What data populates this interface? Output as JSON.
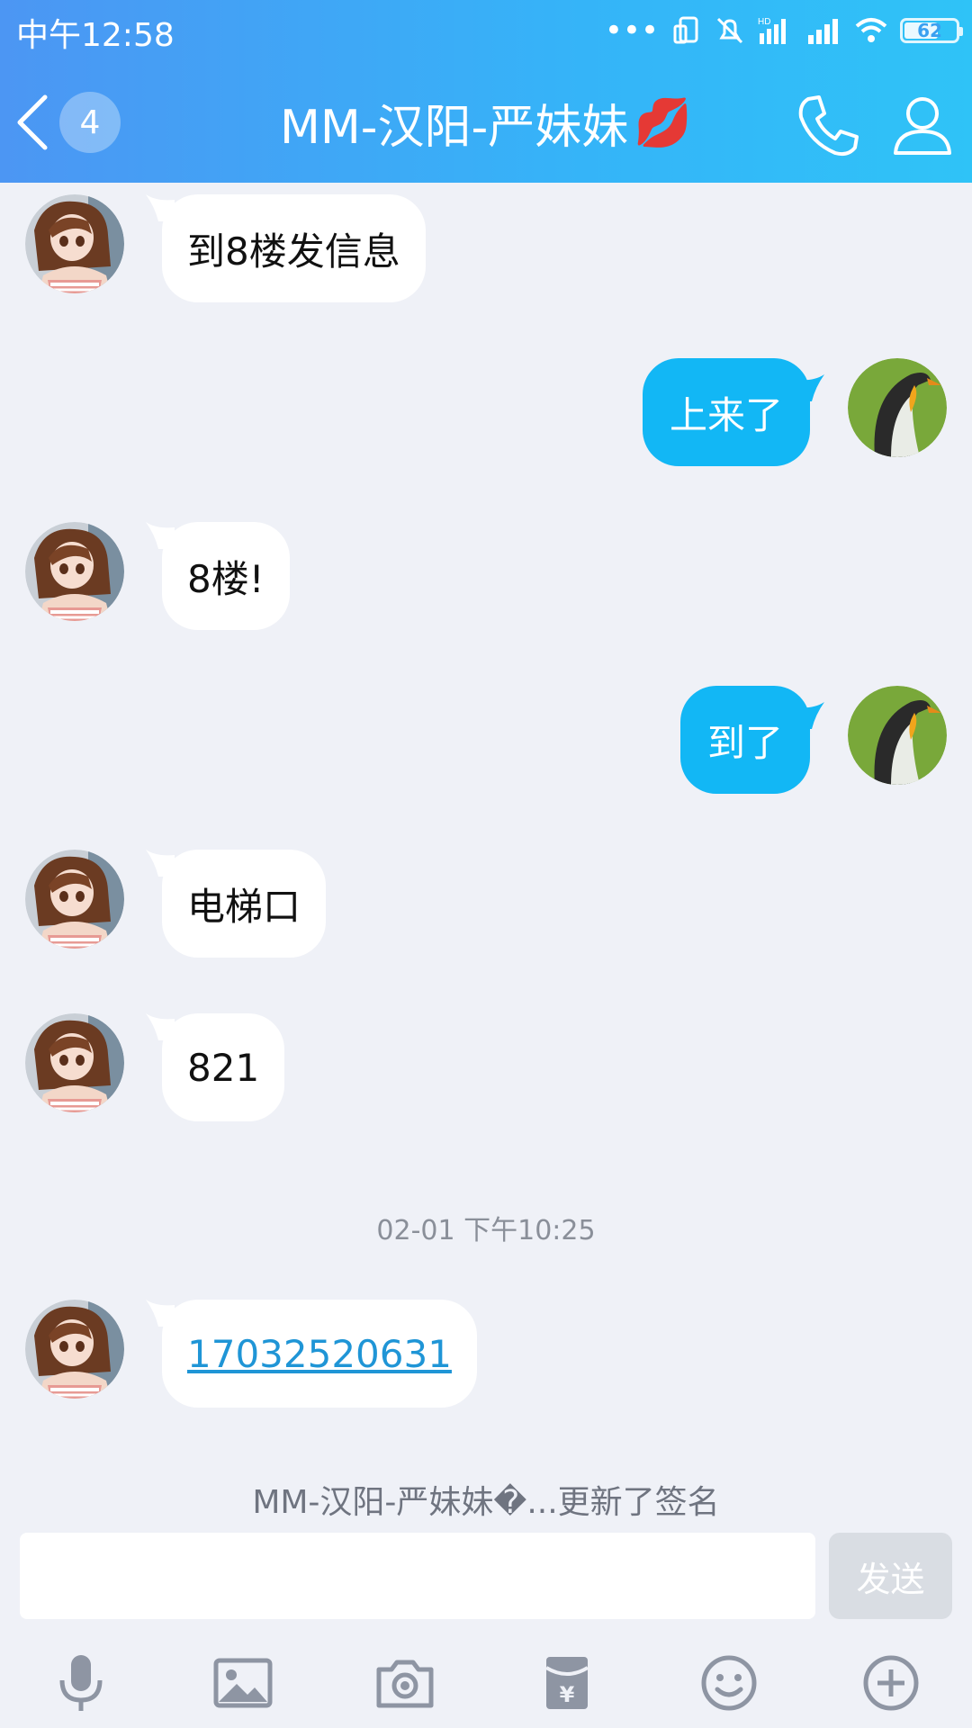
{
  "status_bar": {
    "time": "中午12:58",
    "battery": "62"
  },
  "header": {
    "unread_count": "4",
    "title": "MM-汉阳-严妹妹",
    "title_emoji": "💋"
  },
  "messages": [
    {
      "side": "in",
      "text": "到8楼发信息"
    },
    {
      "side": "out",
      "text": "上来了"
    },
    {
      "side": "in",
      "text": "8楼!"
    },
    {
      "side": "out",
      "text": "到了"
    },
    {
      "side": "in",
      "text": "电梯口"
    },
    {
      "side": "in",
      "text": "821"
    },
    {
      "side": "in",
      "text": "17032520631",
      "is_link": true
    }
  ],
  "timestamp": "02-01 下午10:25",
  "signature_note": "MM-汉阳-严妹妹�...更新了签名",
  "input": {
    "value": "",
    "send_label": "发送"
  },
  "toolbar": [
    "microphone-icon",
    "image-icon",
    "camera-icon",
    "red-packet-icon",
    "emoji-icon",
    "plus-icon"
  ],
  "colors": {
    "header_start": "#4c96f3",
    "header_end": "#2fc3f7",
    "outgoing_bubble": "#12b7f5",
    "background": "#eff1f7",
    "link": "#1f95d6"
  }
}
